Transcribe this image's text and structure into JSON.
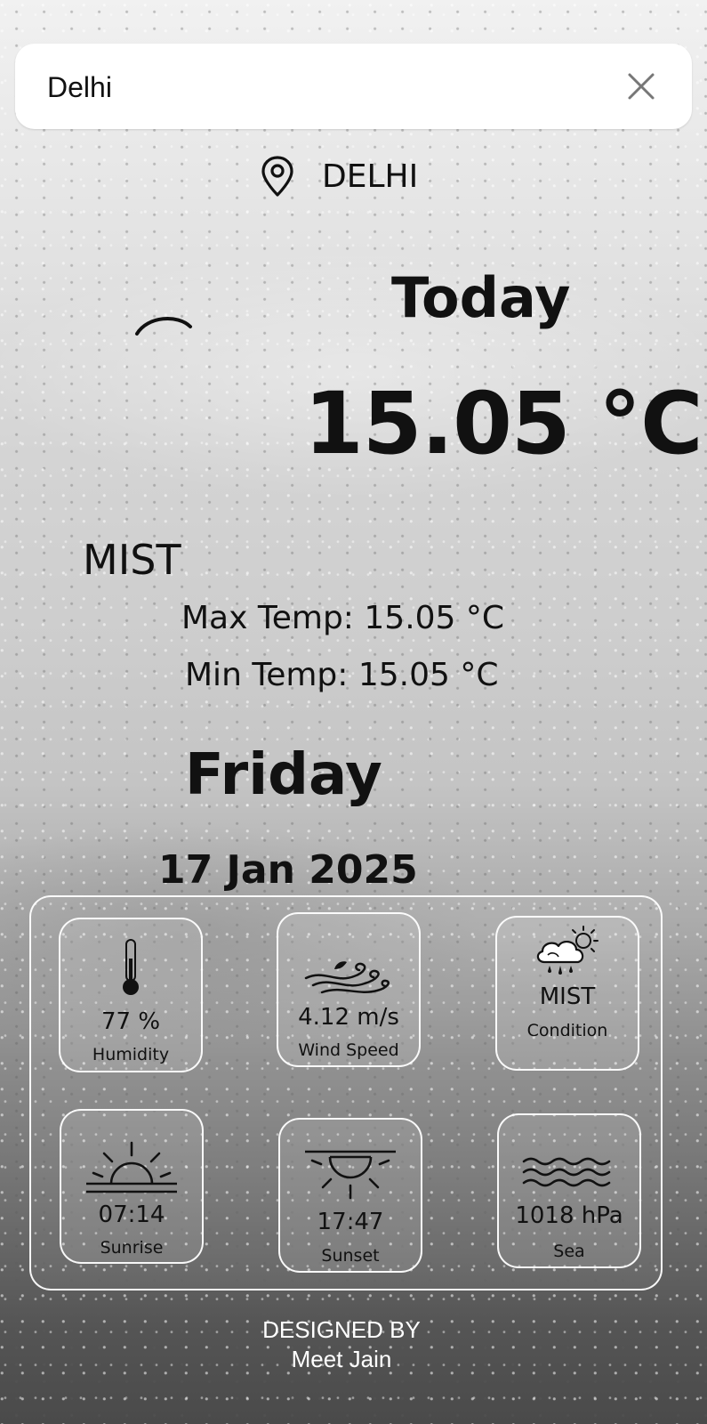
{
  "search": {
    "value": "Delhi",
    "close_icon": "close-icon"
  },
  "location": {
    "icon": "map-pin-icon",
    "city": "DELHI"
  },
  "weather_icon": "weather-arc-icon",
  "main": {
    "today_label": "Today",
    "temperature": "15.05 °C",
    "condition": "MIST",
    "max_temp": "Max Temp: 15.05 °C",
    "min_temp": "Min Temp: 15.05 °C",
    "day": "Friday",
    "date": "17 Jan 2025"
  },
  "details": [
    {
      "icon": "thermometer-icon",
      "value": "77 %",
      "label": "Humidity"
    },
    {
      "icon": "wind-icon",
      "value": "4.12 m/s",
      "label": "Wind Speed"
    },
    {
      "icon": "cloud-sun-rain-icon",
      "value": "MIST",
      "label": "Condition"
    },
    {
      "icon": "sunrise-icon",
      "value": "07:14",
      "label": "Sunrise"
    },
    {
      "icon": "sunset-icon",
      "value": "17:47",
      "label": "Sunset"
    },
    {
      "icon": "waves-icon",
      "value": "1018 hPa",
      "label": "Sea"
    }
  ],
  "footer": {
    "line1": "DESIGNED BY",
    "line2": "Meet Jain"
  }
}
